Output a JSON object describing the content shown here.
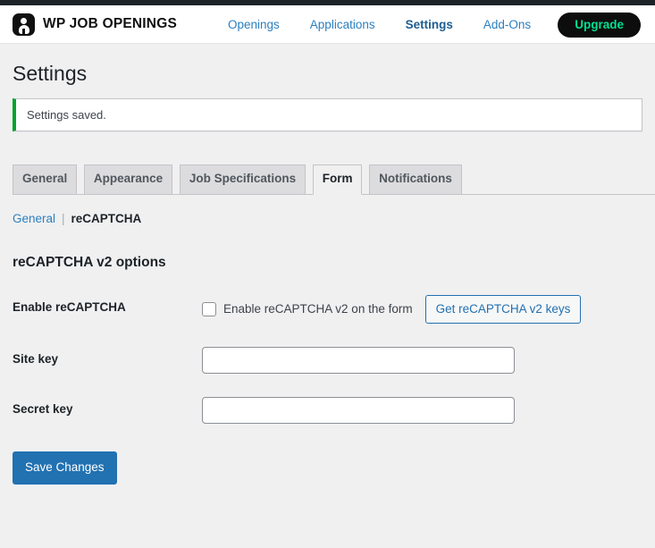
{
  "header": {
    "brand_name": "WP JOB OPENINGS",
    "brand_icon": "user-badge-icon",
    "nav": [
      {
        "label": "Openings",
        "active": false
      },
      {
        "label": "Applications",
        "active": false
      },
      {
        "label": "Settings",
        "active": true
      },
      {
        "label": "Add-Ons",
        "active": false
      }
    ],
    "upgrade_label": "Upgrade",
    "upgrade_bg": "#0d0d0d",
    "upgrade_color": "#00e091"
  },
  "page": {
    "title": "Settings"
  },
  "notice": {
    "message": "Settings saved.",
    "accent_color": "#00a32a"
  },
  "tabs": [
    {
      "label": "General",
      "active": false
    },
    {
      "label": "Appearance",
      "active": false
    },
    {
      "label": "Job Specifications",
      "active": false
    },
    {
      "label": "Form",
      "active": true
    },
    {
      "label": "Notifications",
      "active": false
    }
  ],
  "subnav": {
    "link_label": "General",
    "separator": "|",
    "current_label": "reCAPTCHA"
  },
  "section": {
    "heading": "reCAPTCHA v2 options"
  },
  "fields": {
    "enable": {
      "label": "Enable reCAPTCHA",
      "checkbox_label": "Enable reCAPTCHA v2 on the form",
      "checked": false,
      "button_label": "Get reCAPTCHA v2 keys"
    },
    "site_key": {
      "label": "Site key",
      "value": "",
      "placeholder": ""
    },
    "secret_key": {
      "label": "Secret key",
      "value": "",
      "placeholder": ""
    }
  },
  "submit": {
    "label": "Save Changes",
    "color": "#2271b1"
  }
}
